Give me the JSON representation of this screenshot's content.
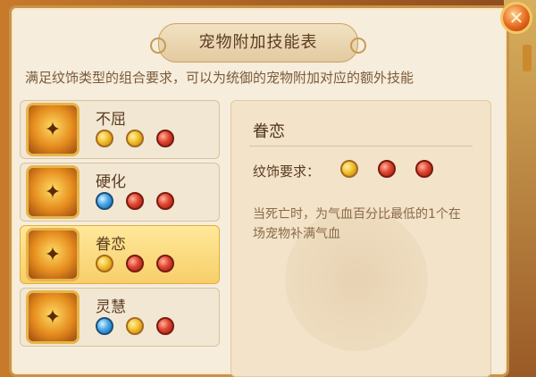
{
  "dialog": {
    "title": "宠物附加技能表",
    "subtitle": "满足纹饰类型的组合要求，可以为统御的宠物附加对应的额外技能",
    "close_icon": "close-x-icon"
  },
  "skills": [
    {
      "name": "不屈",
      "icon": "pet-skill-icon",
      "gems": [
        "gold",
        "gold",
        "red"
      ],
      "selected": false
    },
    {
      "name": "硬化",
      "icon": "pet-skill-icon",
      "gems": [
        "blue",
        "red",
        "red"
      ],
      "selected": false
    },
    {
      "name": "眷恋",
      "icon": "pet-skill-icon",
      "gems": [
        "gold",
        "red",
        "red"
      ],
      "selected": true
    },
    {
      "name": "灵慧",
      "icon": "pet-skill-icon",
      "gems": [
        "blue",
        "gold",
        "red"
      ],
      "selected": false
    }
  ],
  "detail": {
    "name": "眷恋",
    "requirement_label": "纹饰要求：",
    "gems": [
      "gold",
      "red",
      "red"
    ],
    "description": "当死亡时，为气血百分比最低的1个在场宠物补满气血"
  }
}
